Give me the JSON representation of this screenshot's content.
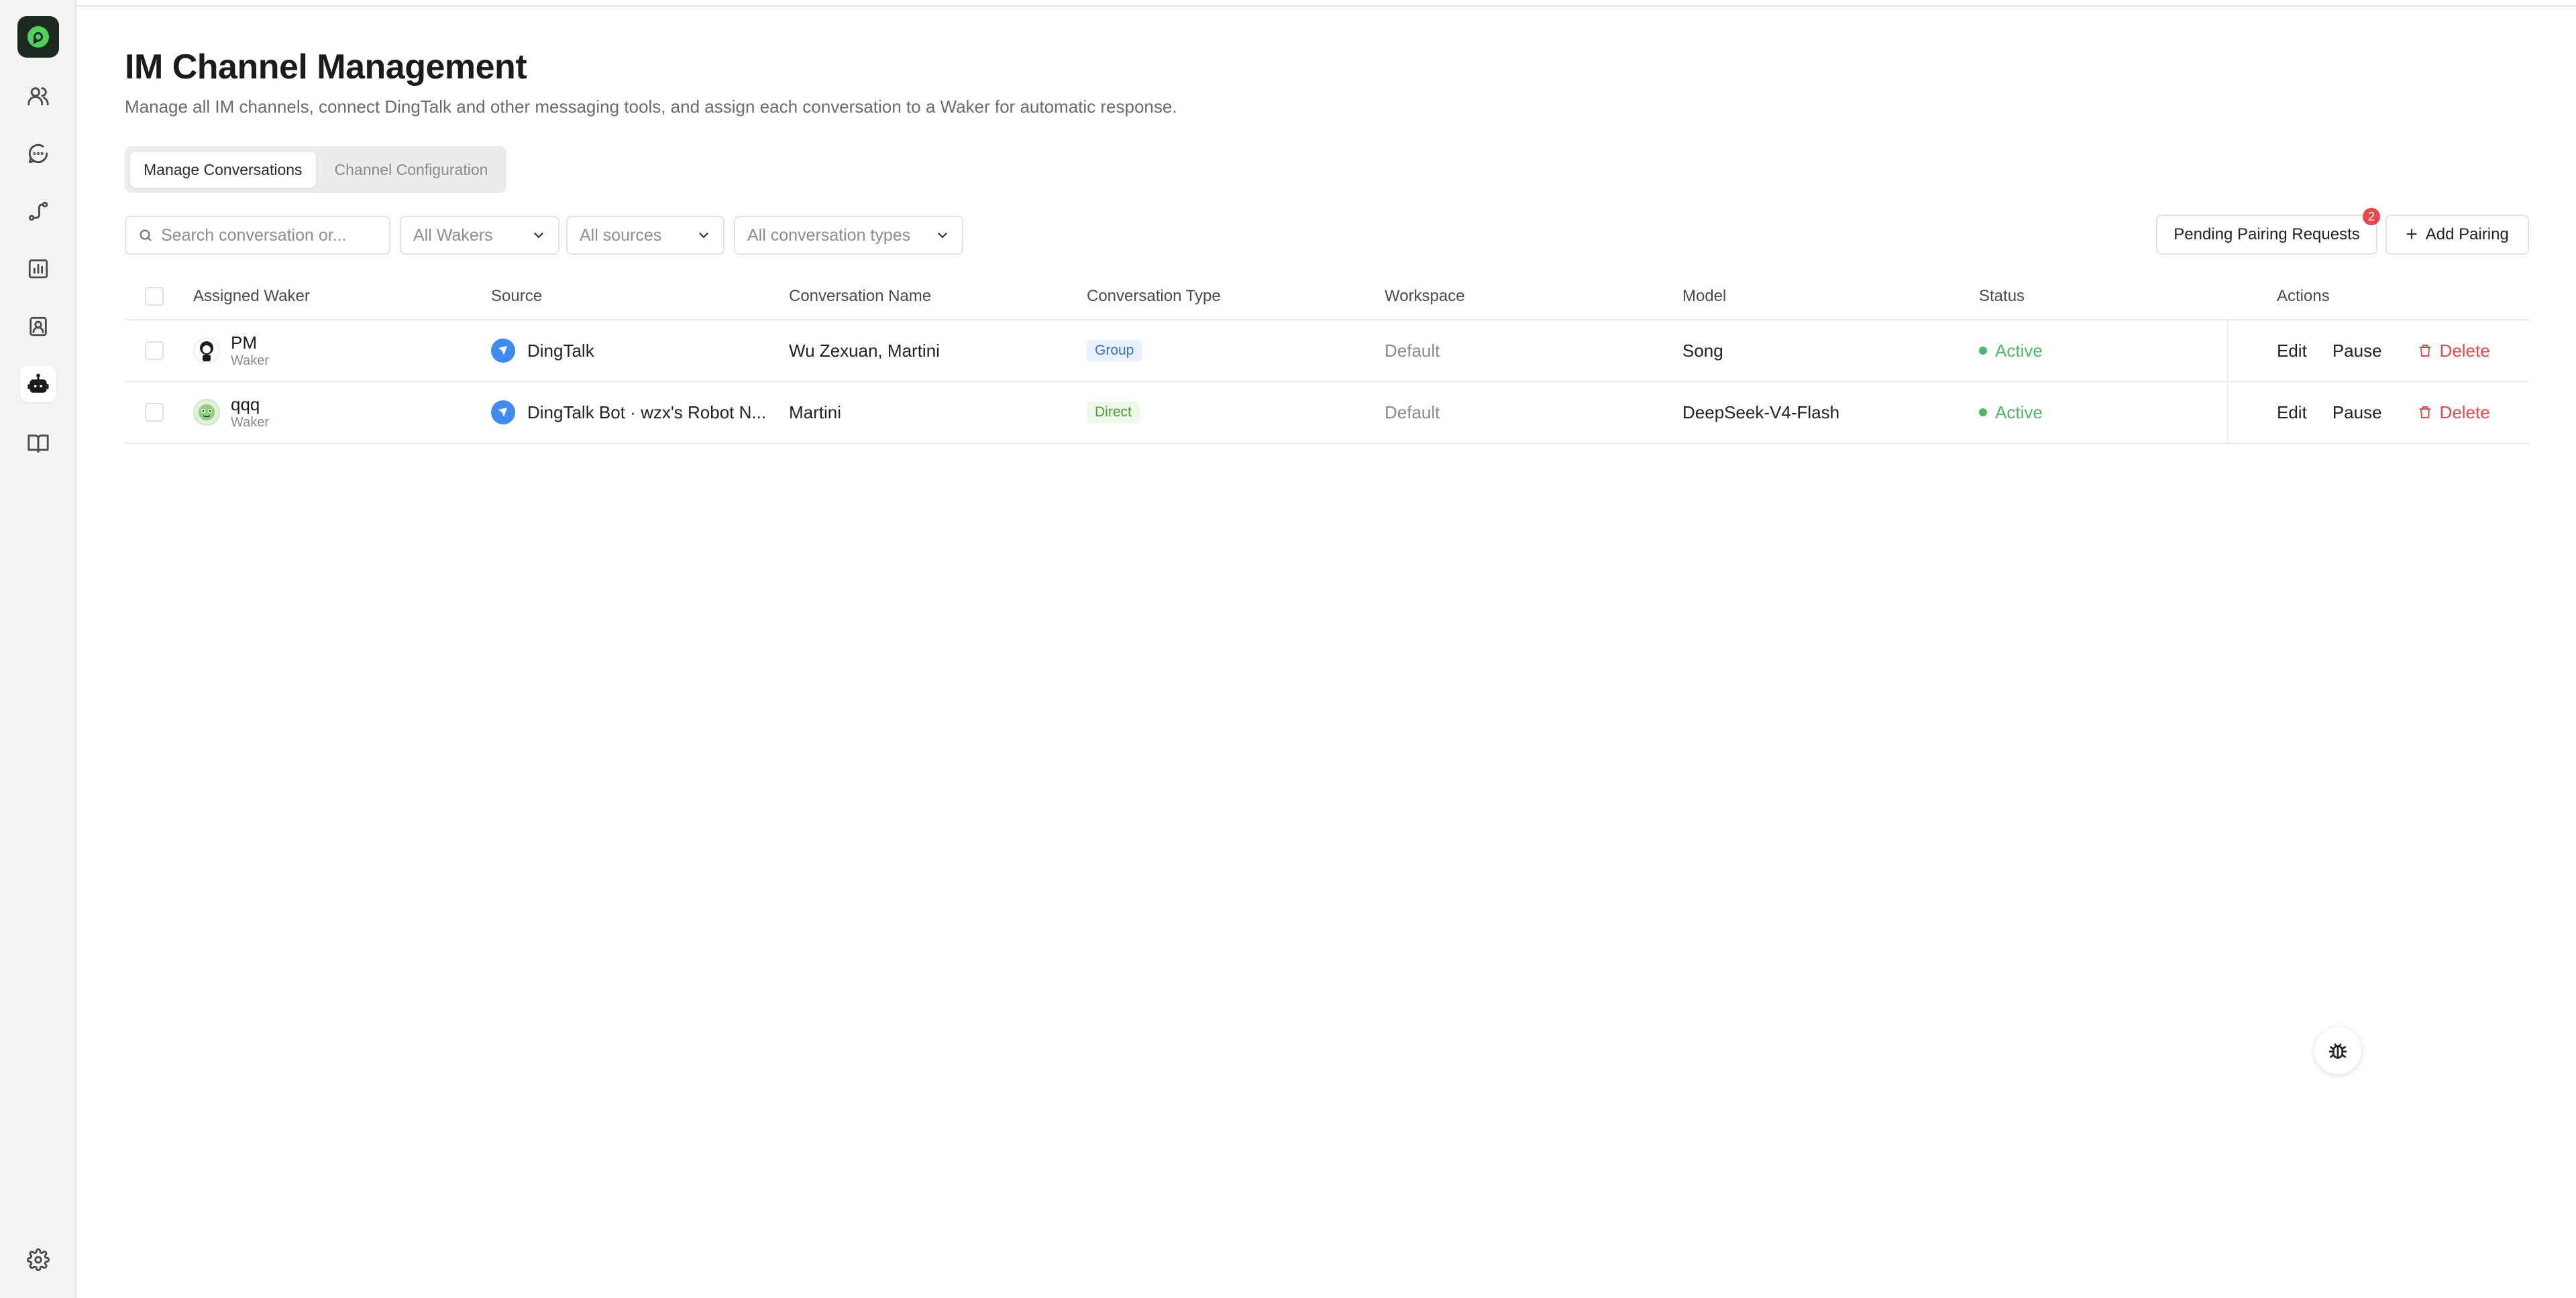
{
  "sidebar": {
    "logo_icon": "app-logo-icon",
    "items": [
      {
        "name": "users-icon",
        "active": false
      },
      {
        "name": "chat-icon",
        "active": false
      },
      {
        "name": "workflow-icon",
        "active": false
      },
      {
        "name": "chart-icon",
        "active": false
      },
      {
        "name": "contacts-icon",
        "active": false
      },
      {
        "name": "robot-icon",
        "active": true
      },
      {
        "name": "book-icon",
        "active": false
      }
    ],
    "settings_icon": "gear-icon"
  },
  "page": {
    "title": "IM Channel Management",
    "subtitle": "Manage all IM channels, connect DingTalk and other messaging tools, and assign each conversation to a Waker for automatic response."
  },
  "tabs": [
    {
      "label": "Manage Conversations",
      "active": true
    },
    {
      "label": "Channel Configuration",
      "active": false
    }
  ],
  "filters": {
    "search_placeholder": "Search conversation or...",
    "wakers": "All Wakers",
    "sources": "All sources",
    "types": "All conversation types"
  },
  "buttons": {
    "pending_label": "Pending Pairing Requests",
    "pending_count": "2",
    "add_label": "Add Pairing"
  },
  "table": {
    "columns": {
      "waker": "Assigned Waker",
      "source": "Source",
      "conversation": "Conversation Name",
      "type": "Conversation Type",
      "workspace": "Workspace",
      "model": "Model",
      "status": "Status",
      "actions": "Actions"
    },
    "rows": [
      {
        "waker": "PM",
        "role": "Waker",
        "source": "DingTalk",
        "conversation": "Wu Zexuan, Martini",
        "type": "Group",
        "workspace": "Default",
        "model": "Song",
        "status": "Active",
        "edit": "Edit",
        "pause": "Pause",
        "delete": "Delete"
      },
      {
        "waker": "qqq",
        "role": "Waker",
        "source": "DingTalk Bot · wzx's Robot N...",
        "conversation": "Martini",
        "type": "Direct",
        "workspace": "Default",
        "model": "DeepSeek-V4-Flash",
        "status": "Active",
        "edit": "Edit",
        "pause": "Pause",
        "delete": "Delete"
      }
    ]
  },
  "colors": {
    "accent_green": "#4fb868",
    "delete_red": "#e5484d",
    "source_blue": "#3d8bf3"
  }
}
